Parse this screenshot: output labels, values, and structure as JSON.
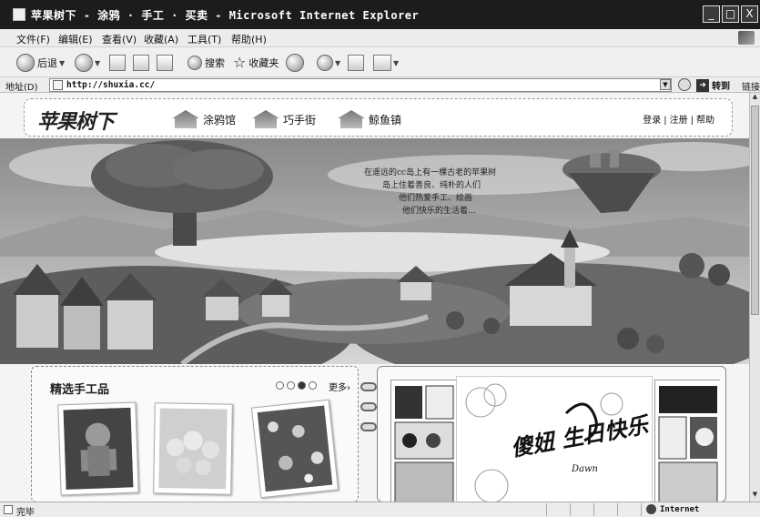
{
  "window": {
    "title": "苹果树下 - 涂鸦 · 手工 · 买卖 - Microsoft Internet Explorer",
    "minimize": "_",
    "maximize": "□",
    "close": "X"
  },
  "menu": [
    "文件(F)",
    "编辑(E)",
    "查看(V)",
    "收藏(A)",
    "工具(T)",
    "帮助(H)"
  ],
  "toolbar": {
    "back": "后退",
    "search": "搜索",
    "favorites": "收藏夹"
  },
  "address": {
    "label": "地址(D)",
    "url": "http://shuxia.cc/",
    "go": "转到",
    "links": "链接"
  },
  "site": {
    "logo": "苹果树下",
    "nav": [
      "涂鸦馆",
      "巧手街",
      "鲸鱼镇"
    ],
    "links": [
      "登录",
      "注册",
      "帮助"
    ],
    "tagline": [
      "在遥远的cc岛上有一棵古老的苹果树",
      "岛上住着善良、纯朴的人们",
      "他们热爱手工、绘画",
      "他们快乐的生活着..."
    ]
  },
  "featured": {
    "title": "精选手工品",
    "more": "更多›",
    "pager_total": 4,
    "pager_active": 3
  },
  "birthday": {
    "text": "傻妞 生日快乐",
    "sign": "Dawn"
  },
  "status": {
    "text": "完毕",
    "zone": "Internet"
  }
}
